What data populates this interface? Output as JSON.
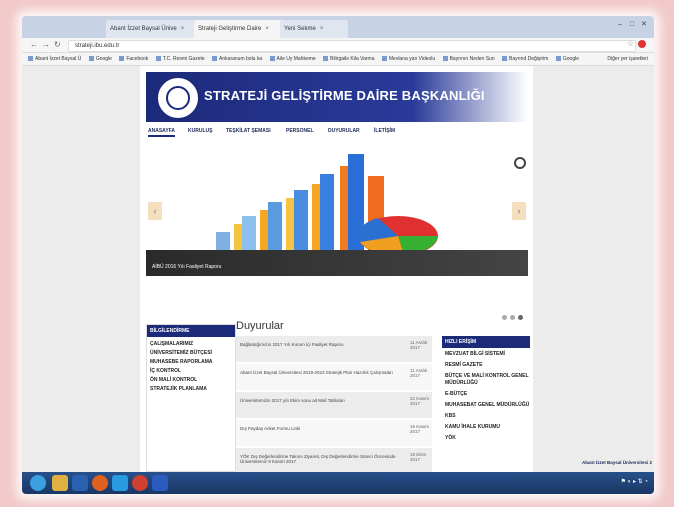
{
  "browser": {
    "tabs": [
      {
        "label": "Abant İzzet Baysal Ünive",
        "active": false
      },
      {
        "label": "Strateji Geliştirme Daire",
        "active": true
      },
      {
        "label": "Yeni Sekme",
        "active": false
      }
    ],
    "url": "strateji.ibu.edu.tr",
    "bookmarks": [
      "Abant İzzet Baysal Ü",
      "Google",
      "Facebook",
      "T.C. Resmi Gazete",
      "Ankaranum bolu ka",
      "Aile Uy Mahkeme",
      "Bilirgaile Kila Varma",
      "Mevlana yan Videolu",
      "Bayrının Neden Sun",
      "Bayrınd Değişirim",
      "Google"
    ],
    "bookmarks_right": "Diğer yer işaretleri",
    "colors": {
      "accent": "#1c2a7a"
    }
  },
  "site": {
    "title": "STRATEJİ GELİŞTİRME DAİRE BAŞKANLIĞI",
    "menu": [
      "ANASAYFA",
      "KURULUŞ",
      "TEŞKİLAT ŞEMASI",
      "PERSONEL",
      "DUYURULAR",
      "İLETİŞİM"
    ],
    "slide_caption": "AİBÜ 2016 Yılı Faaliyet Raporu",
    "left_box": {
      "heading": "BİLGİLENDİRME",
      "items": [
        "ÇALIŞMALARIMIZ",
        "ÜNİVERSİTEMİZ BÜTÇESİ",
        "MUHASEBE RAPORLAMA",
        "İÇ KONTROL",
        "ÖN MALİ KONTROL",
        "STRATEJİK PLANLAMA"
      ]
    },
    "announcements": {
      "title": "Duyurular",
      "rows": [
        {
          "text": "Bağlantığımızın 2017 Yılı Kurum İçi Faaliyet Raporu",
          "date": "11 Aralık 2017"
        },
        {
          "text": "Abant İzzet Baysal Üniversitesi 2019-2023 Stratejik Plan Hazırlık Çalışmaları",
          "date": "11 Aralık 2017"
        },
        {
          "text": "Üniversitemizin 2017 yılı Ekim sonu ait Mali Tabloları",
          "date": "22 Kasım 2017"
        },
        {
          "text": "Dış Paydaş Anket Formu Linki",
          "date": "16 Kasım 2017"
        },
        {
          "text": "YÖK Dış Değerlendirme Takımı Ziyareti, Dış Değerlendirme Süreci Öncesinde Üniversitemiz 9 Kasım 2017",
          "date": "19 Ekim 2017"
        }
      ]
    },
    "right_box": {
      "heading": "HIZLI ERİŞİM",
      "items": [
        "MEVZUAT BİLGİ SİSTEMİ",
        "RESMİ GAZETE",
        "BÜTÇE VE MALİ KONTROL GENEL MÜDÜRLÜĞÜ",
        "E-BÜTÇE",
        "MUHASEBAT GENEL MÜDÜRLÜĞÜ",
        "KBS",
        "KAMU İHALE KURUMU",
        "YÖK"
      ]
    },
    "footer_text": "Abant İzzet Baysal Üniversitesi 2"
  }
}
